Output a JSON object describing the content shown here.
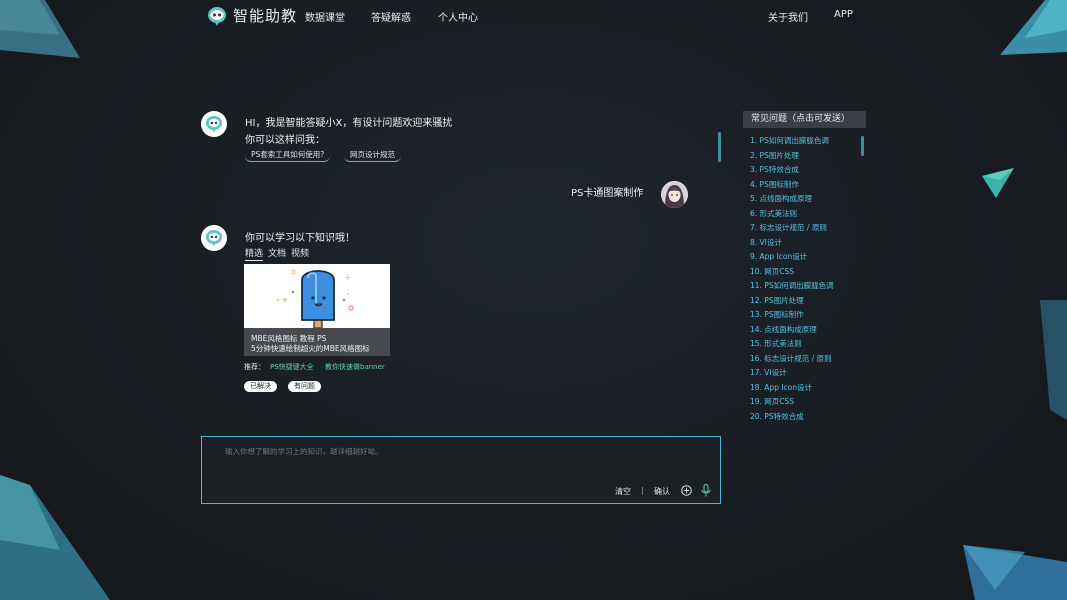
{
  "nav": {
    "logo_text": "智能助教",
    "items": [
      "数据课堂",
      "答疑解惑",
      "个人中心"
    ],
    "right_items": [
      "关于我们",
      "APP"
    ]
  },
  "chat": {
    "greeting": "HI，我是智能答疑小X，有设计问题欢迎来骚扰",
    "prompt": "你可以这样问我：",
    "suggestions": [
      "PS套索工具如何使用?",
      "网页设计规范"
    ],
    "user_message": "PS卡通图案制作",
    "reply_title": "你可以学习以下知识哦！",
    "tabs": [
      "精选",
      "文档",
      "视频"
    ],
    "card": {
      "line1": "MBE风格图标   教程   PS",
      "line2": "5分钟快速绘制超火的MBE风格图标"
    },
    "recommend_label": "推荐：",
    "recommend_links": [
      "PS快捷键大全",
      "教你快速做banner"
    ],
    "feedback": [
      "已解决",
      "有问题"
    ]
  },
  "input": {
    "placeholder": "输入你想了解的学习上的知识，越详细越好呦。",
    "clear": "清空",
    "separator": "|",
    "confirm": "确认"
  },
  "faq": {
    "title": "常见问题（点击可发送）",
    "items": [
      "1. PS如何调出朦胧色调",
      "2. PS图片处理",
      "3. PS特效合成",
      "4. PS图标制作",
      "5. 点线面构成原理",
      "6. 形式美法则",
      "7. 标志设计规范 / 原则",
      "8. VI设计",
      "9. App Icon设计",
      "10. 网页CSS",
      "11. PS如何调出朦胧色调",
      "12. PS图片处理",
      "13. PS图标制作",
      "14. 点线面构成原理",
      "15. 形式美法则",
      "16. 标志设计规范 / 原则",
      "17. VI设计",
      "18. App Icon设计",
      "19. 网页CSS",
      "20. PS特效合成"
    ]
  },
  "colors": {
    "accent": "#4bb7d3",
    "faq_link": "#52c4e6",
    "recommend_link": "#5fd5a2",
    "background": "#1a1f24"
  }
}
